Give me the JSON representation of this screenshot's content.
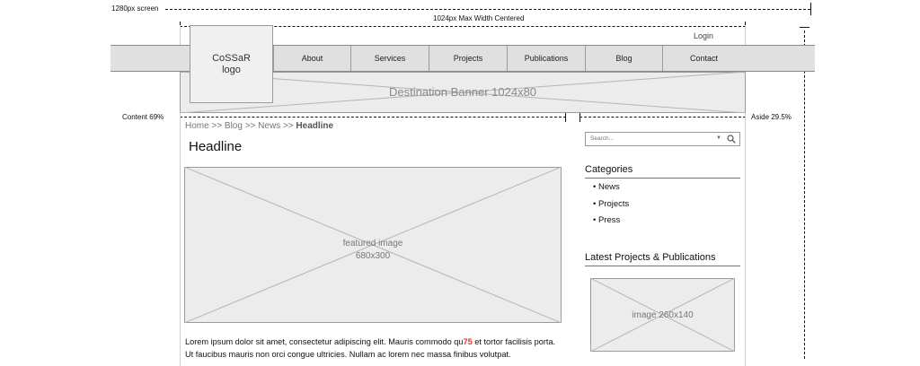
{
  "annotations": {
    "screen": "1280px screen",
    "max_width": "1024px Max Width Centered",
    "content": "Content 69%",
    "aside": "Aside 29.5%"
  },
  "header": {
    "logo_text": "CoSSaR\nlogo",
    "login": "Login",
    "nav": [
      "About",
      "Services",
      "Projects",
      "Publications",
      "Blog",
      "Contact"
    ]
  },
  "banner": {
    "label": "Destination Banner 1024x80"
  },
  "breadcrumb": {
    "trail": "Home >> Blog >> News >> ",
    "current": "Headline"
  },
  "main": {
    "headline": "Headline",
    "featured_image_label": "featured image\n680x300",
    "paragraph_before": "Lorem ipsum dolor sit amet, consectetur adipiscing elit. Mauris commodo qu",
    "paragraph_highlight": "75",
    "paragraph_after": " et tortor facilisis porta. Ut faucibus mauris non orci congue ultricies. Nullam ac lorem nec massa finibus volutpat."
  },
  "aside": {
    "search_placeholder": "Search...",
    "categories_title": "Categories",
    "categories": [
      "• News",
      "• Projects",
      "• Press"
    ],
    "latest_title": "Latest Projects & Publications",
    "image_label": "image 260x140"
  },
  "colors": {
    "highlight": "#e23030",
    "band": "#e0e0e0",
    "placeholder": "#ececec"
  }
}
